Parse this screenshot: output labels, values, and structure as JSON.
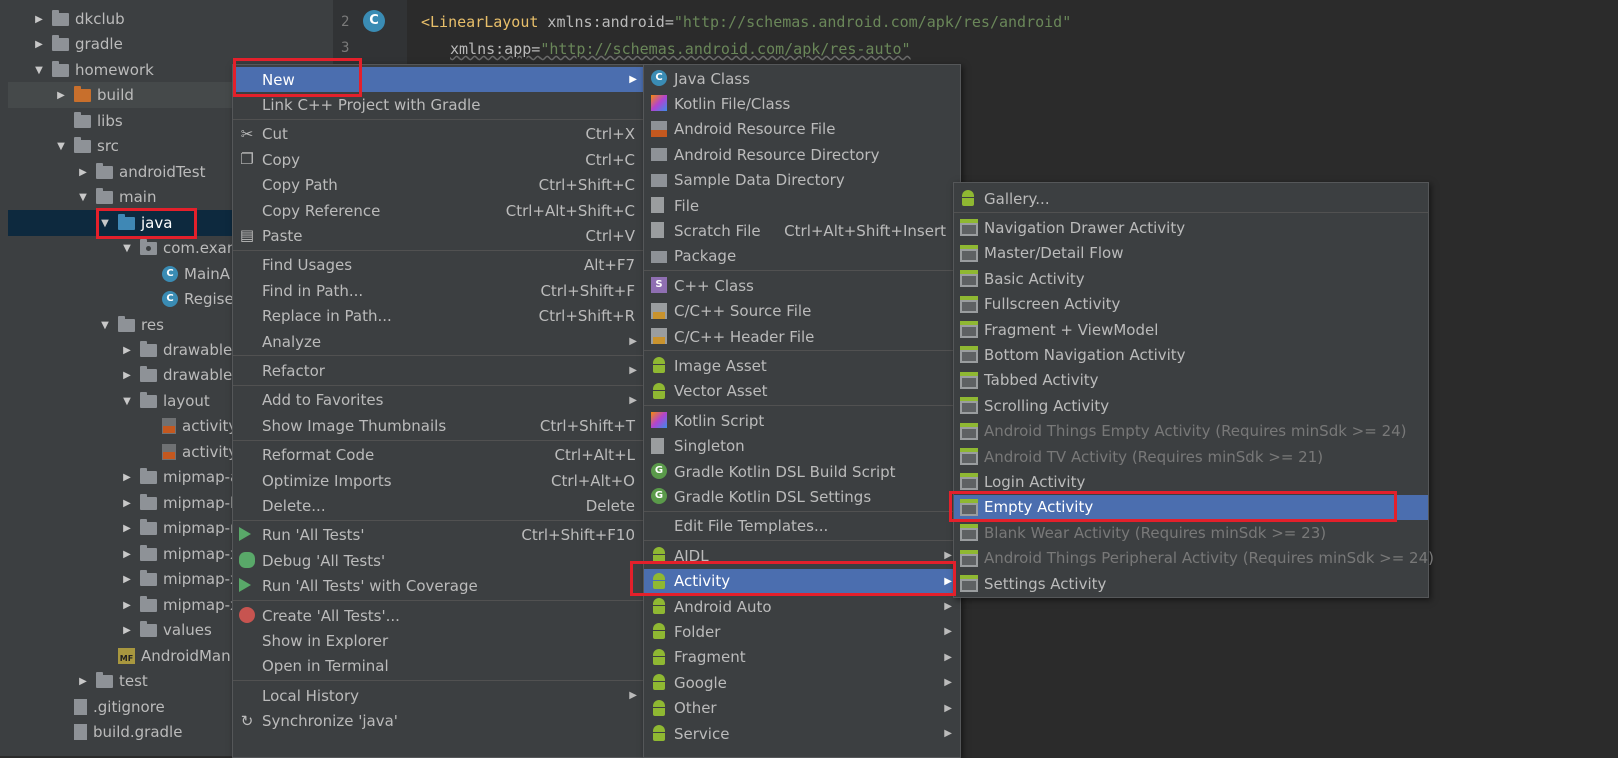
{
  "project_tree": [
    {
      "label": "dkclub",
      "type": "folder",
      "arrow": "▶",
      "indent": 0
    },
    {
      "label": "gradle",
      "type": "folder",
      "arrow": "▶",
      "indent": 0
    },
    {
      "label": "homework",
      "type": "folder",
      "arrow": "▼",
      "indent": 0
    },
    {
      "label": "build",
      "type": "folder-orange",
      "arrow": "▶",
      "indent": 1
    },
    {
      "label": "libs",
      "type": "folder",
      "arrow": "",
      "indent": 1
    },
    {
      "label": "src",
      "type": "folder",
      "arrow": "▼",
      "indent": 1
    },
    {
      "label": "androidTest",
      "type": "folder",
      "arrow": "▶",
      "indent": 2
    },
    {
      "label": "main",
      "type": "folder",
      "arrow": "▼",
      "indent": 2
    },
    {
      "label": "java",
      "type": "folder-blue",
      "arrow": "▼",
      "indent": 3
    },
    {
      "label": "com.exan",
      "type": "package",
      "arrow": "▼",
      "indent": 4
    },
    {
      "label": "MainA",
      "type": "class",
      "arrow": "",
      "indent": 5
    },
    {
      "label": "Regise",
      "type": "class",
      "arrow": "",
      "indent": 5
    },
    {
      "label": "res",
      "type": "folder",
      "arrow": "▼",
      "indent": 3
    },
    {
      "label": "drawable",
      "type": "folder",
      "arrow": "▶",
      "indent": 4
    },
    {
      "label": "drawable-",
      "type": "folder",
      "arrow": "▶",
      "indent": 4
    },
    {
      "label": "layout",
      "type": "folder",
      "arrow": "▼",
      "indent": 4
    },
    {
      "label": "activity",
      "type": "xml",
      "arrow": "",
      "indent": 5
    },
    {
      "label": "activity",
      "type": "xml",
      "arrow": "",
      "indent": 5
    },
    {
      "label": "mipmap-a",
      "type": "folder",
      "arrow": "▶",
      "indent": 4
    },
    {
      "label": "mipmap-h",
      "type": "folder",
      "arrow": "▶",
      "indent": 4
    },
    {
      "label": "mipmap-r",
      "type": "folder",
      "arrow": "▶",
      "indent": 4
    },
    {
      "label": "mipmap-x",
      "type": "folder",
      "arrow": "▶",
      "indent": 4
    },
    {
      "label": "mipmap-x",
      "type": "folder",
      "arrow": "▶",
      "indent": 4
    },
    {
      "label": "mipmap-x",
      "type": "folder",
      "arrow": "▶",
      "indent": 4
    },
    {
      "label": "values",
      "type": "folder",
      "arrow": "▶",
      "indent": 4
    },
    {
      "label": "AndroidMan",
      "type": "manifest",
      "arrow": "",
      "indent": 3
    },
    {
      "label": "test",
      "type": "folder",
      "arrow": "▶",
      "indent": 2
    },
    {
      "label": ".gitignore",
      "type": "file",
      "arrow": "",
      "indent": 1
    },
    {
      "label": "build.gradle",
      "type": "file",
      "arrow": "",
      "indent": 1
    }
  ],
  "editor": {
    "line_numbers": [
      "2",
      "3"
    ],
    "line2": {
      "tag": "<LinearLayout",
      "attr": " xmlns:android=",
      "value": "\"http://schemas.android.com/apk/res/android\""
    },
    "line3": {
      "attr": "xmlns:app=",
      "value": "\"http://schemas.android.com/apk/res-auto\""
    },
    "gutter_icon": "C"
  },
  "context_menu": {
    "items": [
      {
        "label": "New",
        "shortcut": "",
        "submenu": true,
        "icon": "",
        "selected": true
      },
      {
        "label": "Link C++ Project with Gradle",
        "shortcut": "",
        "icon": ""
      },
      {
        "sep": true
      },
      {
        "label": "Cut",
        "shortcut": "Ctrl+X",
        "icon": "scissors-icon"
      },
      {
        "label": "Copy",
        "shortcut": "Ctrl+C",
        "icon": "copy-icon"
      },
      {
        "label": "Copy Path",
        "shortcut": "Ctrl+Shift+C",
        "icon": ""
      },
      {
        "label": "Copy Reference",
        "shortcut": "Ctrl+Alt+Shift+C",
        "icon": ""
      },
      {
        "label": "Paste",
        "shortcut": "Ctrl+V",
        "icon": "paste-icon"
      },
      {
        "sep": true
      },
      {
        "label": "Find Usages",
        "shortcut": "Alt+F7",
        "icon": ""
      },
      {
        "label": "Find in Path...",
        "shortcut": "Ctrl+Shift+F",
        "icon": ""
      },
      {
        "label": "Replace in Path...",
        "shortcut": "Ctrl+Shift+R",
        "icon": ""
      },
      {
        "label": "Analyze",
        "shortcut": "",
        "submenu": true,
        "icon": ""
      },
      {
        "sep": true
      },
      {
        "label": "Refactor",
        "shortcut": "",
        "submenu": true,
        "icon": ""
      },
      {
        "sep": true
      },
      {
        "label": "Add to Favorites",
        "shortcut": "",
        "submenu": true,
        "icon": ""
      },
      {
        "label": "Show Image Thumbnails",
        "shortcut": "Ctrl+Shift+T",
        "icon": ""
      },
      {
        "sep": true
      },
      {
        "label": "Reformat Code",
        "shortcut": "Ctrl+Alt+L",
        "icon": ""
      },
      {
        "label": "Optimize Imports",
        "shortcut": "Ctrl+Alt+O",
        "icon": ""
      },
      {
        "label": "Delete...",
        "shortcut": "Delete",
        "icon": ""
      },
      {
        "sep": true
      },
      {
        "label": "Run 'All Tests'",
        "shortcut": "Ctrl+Shift+F10",
        "icon": "run-icon"
      },
      {
        "label": "Debug 'All Tests'",
        "shortcut": "",
        "icon": "debug-icon"
      },
      {
        "label": "Run 'All Tests' with Coverage",
        "shortcut": "",
        "icon": "coverage-icon"
      },
      {
        "sep": true
      },
      {
        "label": "Create 'All Tests'...",
        "shortcut": "",
        "icon": "create-test-icon"
      },
      {
        "label": "Show in Explorer",
        "shortcut": "",
        "icon": ""
      },
      {
        "label": "Open in Terminal",
        "shortcut": "",
        "icon": ""
      },
      {
        "sep": true
      },
      {
        "label": "Local History",
        "shortcut": "",
        "submenu": true,
        "icon": ""
      },
      {
        "label": "Synchronize 'java'",
        "shortcut": "",
        "icon": "sync-icon"
      }
    ]
  },
  "new_menu": {
    "items": [
      {
        "label": "Java Class",
        "shortcut": "",
        "icon": "java-class-icon"
      },
      {
        "label": "Kotlin File/Class",
        "shortcut": "",
        "icon": "kotlin-icon"
      },
      {
        "label": "Android Resource File",
        "shortcut": "",
        "icon": "resource-file-icon"
      },
      {
        "label": "Android Resource Directory",
        "shortcut": "",
        "icon": "folder-icon"
      },
      {
        "label": "Sample Data Directory",
        "shortcut": "",
        "icon": "folder-icon"
      },
      {
        "label": "File",
        "shortcut": "",
        "icon": "file-icon"
      },
      {
        "label": "Scratch File",
        "shortcut": "Ctrl+Alt+Shift+Insert",
        "icon": "scratch-icon"
      },
      {
        "label": "Package",
        "shortcut": "",
        "icon": "package-icon"
      },
      {
        "sep": true
      },
      {
        "label": "C++ Class",
        "shortcut": "",
        "icon": "cpp-class-icon"
      },
      {
        "label": "C/C++ Source File",
        "shortcut": "",
        "icon": "cpp-source-icon"
      },
      {
        "label": "C/C++ Header File",
        "shortcut": "",
        "icon": "cpp-header-icon"
      },
      {
        "sep": true
      },
      {
        "label": "Image Asset",
        "shortcut": "",
        "icon": "android-icon"
      },
      {
        "label": "Vector Asset",
        "shortcut": "",
        "icon": "android-icon"
      },
      {
        "sep": true
      },
      {
        "label": "Kotlin Script",
        "shortcut": "",
        "icon": "kotlin-icon"
      },
      {
        "label": "Singleton",
        "shortcut": "",
        "icon": "singleton-icon"
      },
      {
        "label": "Gradle Kotlin DSL Build Script",
        "shortcut": "",
        "icon": "gradle-icon"
      },
      {
        "label": "Gradle Kotlin DSL Settings",
        "shortcut": "",
        "icon": "gradle-icon"
      },
      {
        "sep": true
      },
      {
        "label": "Edit File Templates...",
        "shortcut": "",
        "icon": ""
      },
      {
        "sep": true
      },
      {
        "label": "AIDL",
        "shortcut": "",
        "submenu": true,
        "icon": "android-icon"
      },
      {
        "label": "Activity",
        "shortcut": "",
        "submenu": true,
        "icon": "android-icon",
        "selected": true
      },
      {
        "label": "Android Auto",
        "shortcut": "",
        "submenu": true,
        "icon": "android-icon"
      },
      {
        "label": "Folder",
        "shortcut": "",
        "submenu": true,
        "icon": "android-icon"
      },
      {
        "label": "Fragment",
        "shortcut": "",
        "submenu": true,
        "icon": "android-icon"
      },
      {
        "label": "Google",
        "shortcut": "",
        "submenu": true,
        "icon": "android-icon"
      },
      {
        "label": "Other",
        "shortcut": "",
        "submenu": true,
        "icon": "android-icon"
      },
      {
        "label": "Service",
        "shortcut": "",
        "submenu": true,
        "icon": "android-icon"
      }
    ]
  },
  "activity_menu": {
    "items": [
      {
        "label": "Gallery...",
        "icon": "android-icon"
      },
      {
        "sep": true
      },
      {
        "label": "Navigation Drawer Activity",
        "icon": "activity-template-icon"
      },
      {
        "label": "Master/Detail Flow",
        "icon": "activity-template-icon"
      },
      {
        "label": "Basic Activity",
        "icon": "activity-template-icon"
      },
      {
        "label": "Fullscreen Activity",
        "icon": "activity-template-icon"
      },
      {
        "label": "Fragment + ViewModel",
        "icon": "activity-template-icon"
      },
      {
        "label": "Bottom Navigation Activity",
        "icon": "activity-template-icon"
      },
      {
        "label": "Tabbed Activity",
        "icon": "activity-template-icon"
      },
      {
        "label": "Scrolling Activity",
        "icon": "activity-template-icon"
      },
      {
        "label": "Android Things Empty Activity (Requires minSdk >= 24)",
        "icon": "activity-template-icon",
        "disabled": true
      },
      {
        "label": "Android TV Activity (Requires minSdk >= 21)",
        "icon": "activity-template-icon",
        "disabled": true
      },
      {
        "label": "Login Activity",
        "icon": "activity-template-icon"
      },
      {
        "label": "Empty Activity",
        "icon": "activity-template-icon",
        "selected": true
      },
      {
        "label": "Blank Wear Activity (Requires minSdk >= 23)",
        "icon": "activity-template-icon",
        "disabled": true
      },
      {
        "label": "Android Things Peripheral Activity (Requires minSdk >= 24)",
        "icon": "activity-template-icon",
        "disabled": true
      },
      {
        "label": "Settings Activity",
        "icon": "activity-template-icon"
      }
    ]
  },
  "colors": {
    "selection": "#4b6eaf",
    "highlight_box": "#e3202b",
    "menu_bg": "#3c3f41",
    "editor_bg": "#2b2b2b"
  }
}
